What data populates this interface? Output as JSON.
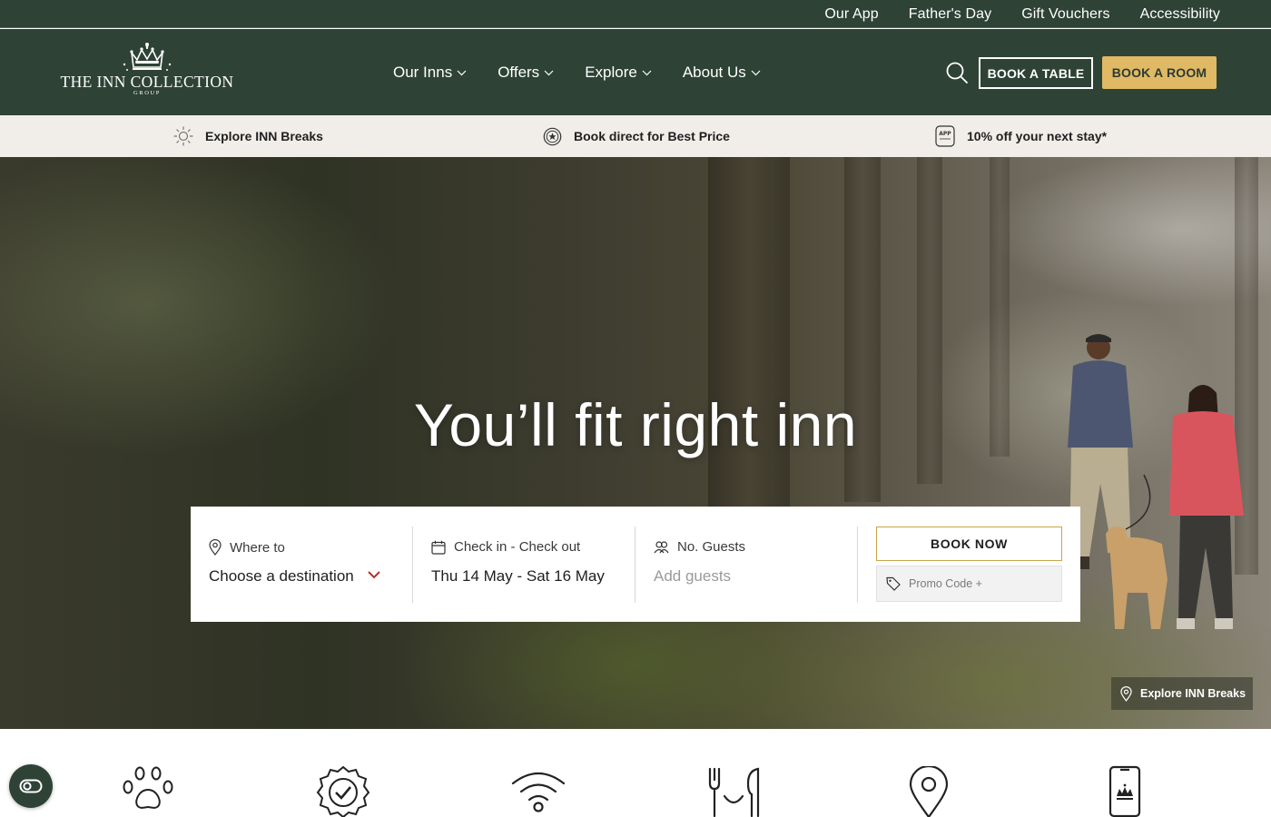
{
  "utility_nav": [
    "Our App",
    "Father's Day",
    "Gift Vouchers",
    "Accessibility"
  ],
  "logo": {
    "wordmark": "THE INN COLLECTION",
    "subline": "GROUP"
  },
  "main_nav": [
    {
      "label": "Our Inns"
    },
    {
      "label": "Offers"
    },
    {
      "label": "Explore"
    },
    {
      "label": "About Us"
    }
  ],
  "header_buttons": {
    "book_table": "BOOK A TABLE",
    "book_room": "BOOK A ROOM"
  },
  "usp": [
    {
      "icon": "sun-icon",
      "label": "Explore INN Breaks"
    },
    {
      "icon": "best-price-badge-icon",
      "label": "Book direct for Best Price"
    },
    {
      "icon": "app-icon",
      "label": "10% off your next stay*"
    }
  ],
  "hero": {
    "headline": "You’ll fit right inn"
  },
  "booking": {
    "destination": {
      "label": "Where to",
      "value": "Choose a destination"
    },
    "dates": {
      "label": "Check in - Check out",
      "value": "Thu 14 May - Sat 16 May"
    },
    "guests": {
      "label": "No. Guests",
      "placeholder": "Add guests"
    },
    "book_now": "BOOK NOW",
    "promo_placeholder": "Promo Code +"
  },
  "explore_chip": "Explore INN Breaks",
  "features": [
    "paw-icon",
    "verified-badge-icon",
    "wifi-icon",
    "dining-icon",
    "location-pin-icon",
    "mobile-app-icon"
  ],
  "colors": {
    "brand_green": "#2e4236",
    "gold": "#e0b964",
    "strip": "#f1eeea"
  }
}
